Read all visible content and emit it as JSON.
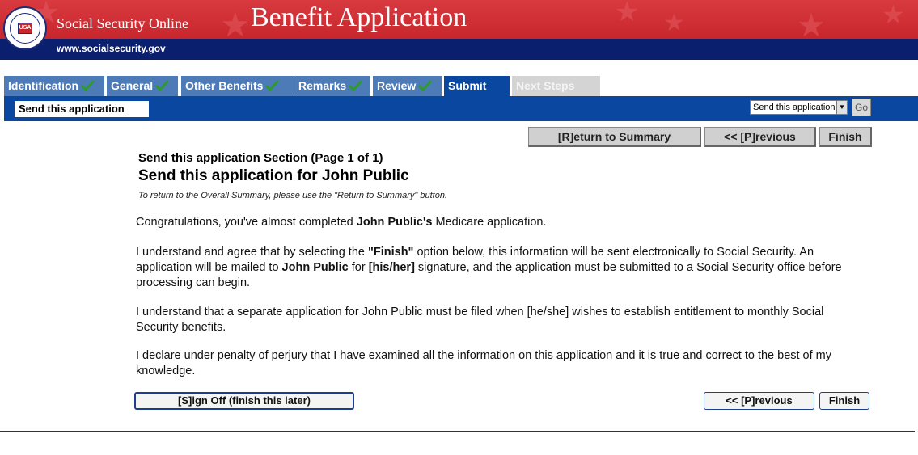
{
  "banner": {
    "site_name": "Social Security Online",
    "title": "Benefit Application",
    "url": "www.socialsecurity.gov",
    "seal_text": "USA"
  },
  "tabs": [
    {
      "label": "Identification",
      "state": "complete"
    },
    {
      "label": "General",
      "state": "complete"
    },
    {
      "label": "Other Benefits",
      "state": "complete"
    },
    {
      "label": "Remarks",
      "state": "complete"
    },
    {
      "label": "Review",
      "state": "complete"
    },
    {
      "label": "Submit",
      "state": "active"
    },
    {
      "label": "Next Steps",
      "state": "future"
    }
  ],
  "section_bar": {
    "label": "Send this application",
    "jump_select_value": "Send this application",
    "go_label": "Go"
  },
  "nav": {
    "return_label": "[R]eturn to Summary",
    "previous_label": "<< [P]revious",
    "finish_label": "Finish"
  },
  "content": {
    "section_heading": "Send this application Section (Page 1 of 1)",
    "title": "Send this application for John Public",
    "hint": "To return to the Overall Summary, please use the \"Return to Summary\" button.",
    "p1_a": "Congratulations, you've almost completed ",
    "p1_b": "John Public's",
    "p1_c": " Medicare application.",
    "p2_a": "I understand and agree that by selecting the ",
    "p2_b": "\"Finish\"",
    "p2_c": " option below, this information will be sent electronically to Social Security.  An application will be mailed to ",
    "p2_d": "John Public",
    "p2_e": " for ",
    "p2_f": "[his/her]",
    "p2_g": " signature, and the application must be submitted to a Social Security office before processing can begin.",
    "p3": "I understand that a separate application for John Public must be filed when [he/she] wishes to establish entitlement to monthly Social Security benefits.",
    "p4": "I declare under penalty of perjury that I have examined all the information on this application and it is true and correct to the best of my knowledge."
  },
  "bottom": {
    "signoff_label": "[S]ign Off (finish this later)",
    "previous_label": "<< [P]revious",
    "finish_label": "Finish"
  },
  "colors": {
    "banner_red": "#c8262d",
    "banner_blue": "#0a1f6e",
    "tab_complete": "#4d7bb8",
    "tab_active": "#0a47a0",
    "tab_future": "#d4d4d4",
    "check_green": "#2e9a2e"
  }
}
